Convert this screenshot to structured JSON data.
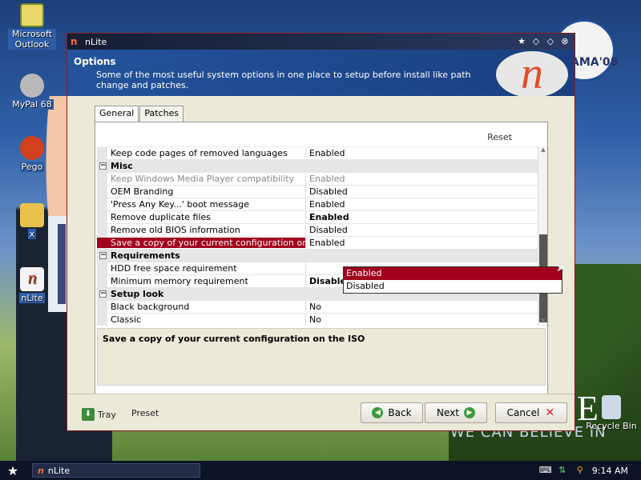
{
  "desktop": {
    "icons": [
      {
        "label": "Microsoft Outlook"
      },
      {
        "label": "MyPal 68"
      },
      {
        "label": "Pego"
      },
      {
        "label": "x"
      },
      {
        "label": "nLite"
      },
      {
        "label": "Recycle Bin"
      }
    ],
    "wallpaper_logo_text": "AMA'08",
    "wallpaper_slogan": "WE CAN BELIEVE IN"
  },
  "window": {
    "title": "nLite",
    "header_title": "Options",
    "header_desc": "Some of the most useful system options in one place to setup before install like path change and patches.",
    "logo_glyph": "n"
  },
  "tabs": [
    {
      "label": "General",
      "active": true
    },
    {
      "label": "Patches",
      "active": false
    }
  ],
  "reset_label": "Reset",
  "rows": [
    {
      "type": "item",
      "name": "Keep code pages of removed languages",
      "value": "Enabled"
    },
    {
      "type": "category",
      "name": "Misc"
    },
    {
      "type": "item",
      "name": "Keep Windows Media Player compatibility",
      "value": "Enabled",
      "muted": true
    },
    {
      "type": "item",
      "name": "OEM Branding",
      "value": "Disabled"
    },
    {
      "type": "item",
      "name": "'Press Any Key...' boot message",
      "value": "Enabled"
    },
    {
      "type": "item",
      "name": "Remove duplicate files",
      "value": "Enabled",
      "bold": true
    },
    {
      "type": "item",
      "name": "Remove old BIOS information",
      "value": "Disabled"
    },
    {
      "type": "item",
      "name": "Save a copy of your current configuration on the ISO",
      "value": "Enabled",
      "selected": true
    },
    {
      "type": "category",
      "name": "Requirements"
    },
    {
      "type": "item",
      "name": "HDD free space requirement",
      "value": ""
    },
    {
      "type": "item",
      "name": "Minimum memory requirement",
      "value": "Disabled",
      "bold": true
    },
    {
      "type": "category",
      "name": "Setup look"
    },
    {
      "type": "item",
      "name": "Black background",
      "value": "No"
    },
    {
      "type": "item",
      "name": "Classic",
      "value": "No"
    }
  ],
  "dropdown": {
    "options": [
      "Enabled",
      "Disabled"
    ],
    "selected": "Enabled"
  },
  "description": "Save a copy of your current configuration on the ISO",
  "footer": {
    "tray_label": "Tray",
    "preset_label": "Preset",
    "back_label": "Back",
    "next_label": "Next",
    "cancel_label": "Cancel"
  },
  "taskbar": {
    "task_label": "nLite",
    "clock": "9:14 AM"
  },
  "colors": {
    "selection": "#a0001b",
    "header_blue": "#1f4a90",
    "window_border": "#8a1a1a"
  }
}
